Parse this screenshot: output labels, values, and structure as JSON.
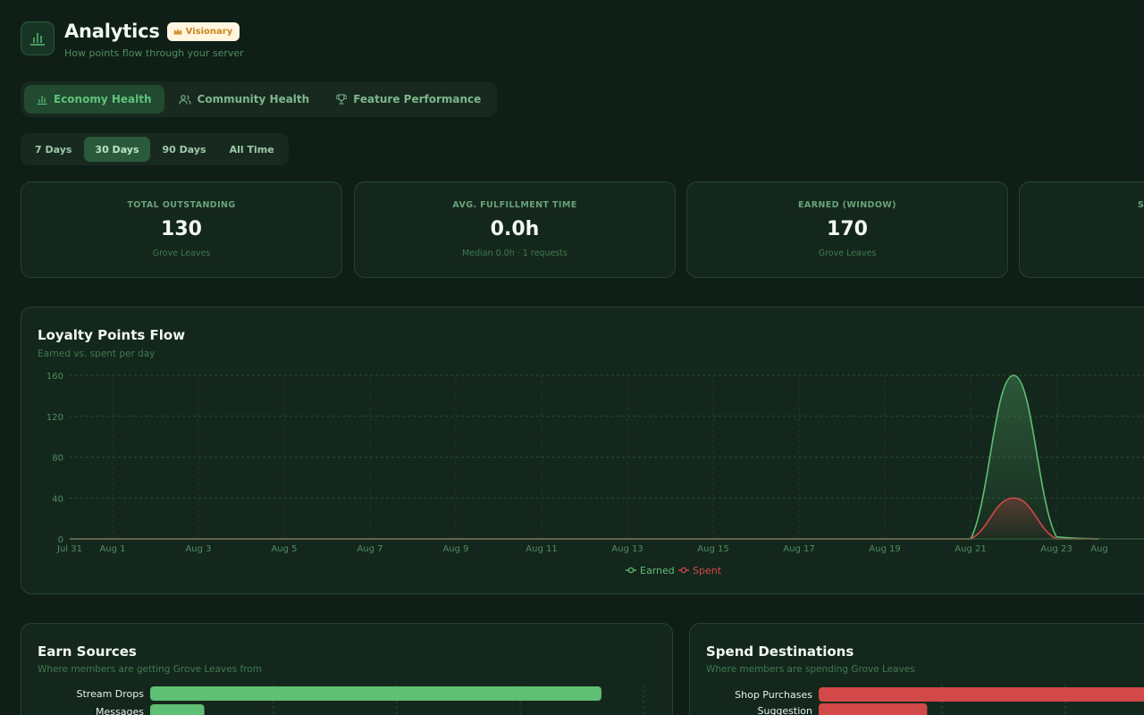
{
  "header": {
    "title": "Analytics",
    "badge": "Visionary",
    "subtitle": "How points flow through your server"
  },
  "tabs": [
    {
      "label": "Economy Health",
      "icon": "bar-chart-icon",
      "active": true
    },
    {
      "label": "Community Health",
      "icon": "users-icon",
      "active": false
    },
    {
      "label": "Feature Performance",
      "icon": "trophy-icon",
      "active": false
    }
  ],
  "ranges": [
    {
      "label": "7 Days",
      "active": false
    },
    {
      "label": "30 Days",
      "active": true
    },
    {
      "label": "90 Days",
      "active": false
    },
    {
      "label": "All Time",
      "active": false
    }
  ],
  "stats": [
    {
      "label": "TOTAL OUTSTANDING",
      "value": "130",
      "sub": "Grove Leaves"
    },
    {
      "label": "AVG. FULFILLMENT TIME",
      "value": "0.0h",
      "sub": "Median 0.0h · 1 requests"
    },
    {
      "label": "EARNED (WINDOW)",
      "value": "170",
      "sub": "Grove Leaves"
    },
    {
      "label": "S",
      "value": "",
      "sub": ""
    }
  ],
  "flow": {
    "title": "Loyalty Points Flow",
    "subtitle": "Earned vs. spent per day"
  },
  "earn": {
    "title": "Earn Sources",
    "subtitle": "Where members are getting Grove Leaves from"
  },
  "spend": {
    "title": "Spend Destinations",
    "subtitle": "Where members are spending Grove Leaves"
  },
  "colors": {
    "earned": "#5fbf74",
    "spent": "#d34848",
    "accent": "#5fc37a"
  },
  "chart_data": [
    {
      "type": "area",
      "title": "Loyalty Points Flow",
      "x": [
        "Jul 31",
        "Aug 1",
        "Aug 2",
        "Aug 3",
        "Aug 4",
        "Aug 5",
        "Aug 6",
        "Aug 7",
        "Aug 8",
        "Aug 9",
        "Aug 10",
        "Aug 11",
        "Aug 12",
        "Aug 13",
        "Aug 14",
        "Aug 15",
        "Aug 16",
        "Aug 17",
        "Aug 18",
        "Aug 19",
        "Aug 20",
        "Aug 21",
        "Aug 22",
        "Aug 23",
        "Aug 24"
      ],
      "tick_labels": [
        "Jul 31",
        "Aug 1",
        "Aug 3",
        "Aug 5",
        "Aug 7",
        "Aug 9",
        "Aug 11",
        "Aug 13",
        "Aug 15",
        "Aug 17",
        "Aug 19",
        "Aug 21",
        "Aug 23",
        "Aug"
      ],
      "series": [
        {
          "name": "Earned",
          "values": [
            0,
            0,
            0,
            0,
            0,
            0,
            0,
            0,
            0,
            0,
            0,
            0,
            0,
            0,
            0,
            0,
            0,
            0,
            0,
            0,
            0,
            0,
            160,
            2,
            0
          ]
        },
        {
          "name": "Spent",
          "values": [
            0,
            0,
            0,
            0,
            0,
            0,
            0,
            0,
            0,
            0,
            0,
            0,
            0,
            0,
            0,
            0,
            0,
            0,
            0,
            0,
            0,
            0,
            40,
            0,
            0
          ]
        }
      ],
      "ylim": [
        0,
        160
      ],
      "yticks": [
        0,
        40,
        80,
        120,
        160
      ],
      "grid": true,
      "legend": "bottom-center"
    },
    {
      "type": "bar",
      "orientation": "horizontal",
      "title": "Earn Sources",
      "categories": [
        "Stream Drops",
        "Messages"
      ],
      "values": [
        150,
        18
      ]
    },
    {
      "type": "bar",
      "orientation": "horizontal",
      "title": "Spend Destinations",
      "categories": [
        "Shop Purchases",
        "Suggestion"
      ],
      "values": [
        130,
        40
      ]
    }
  ]
}
